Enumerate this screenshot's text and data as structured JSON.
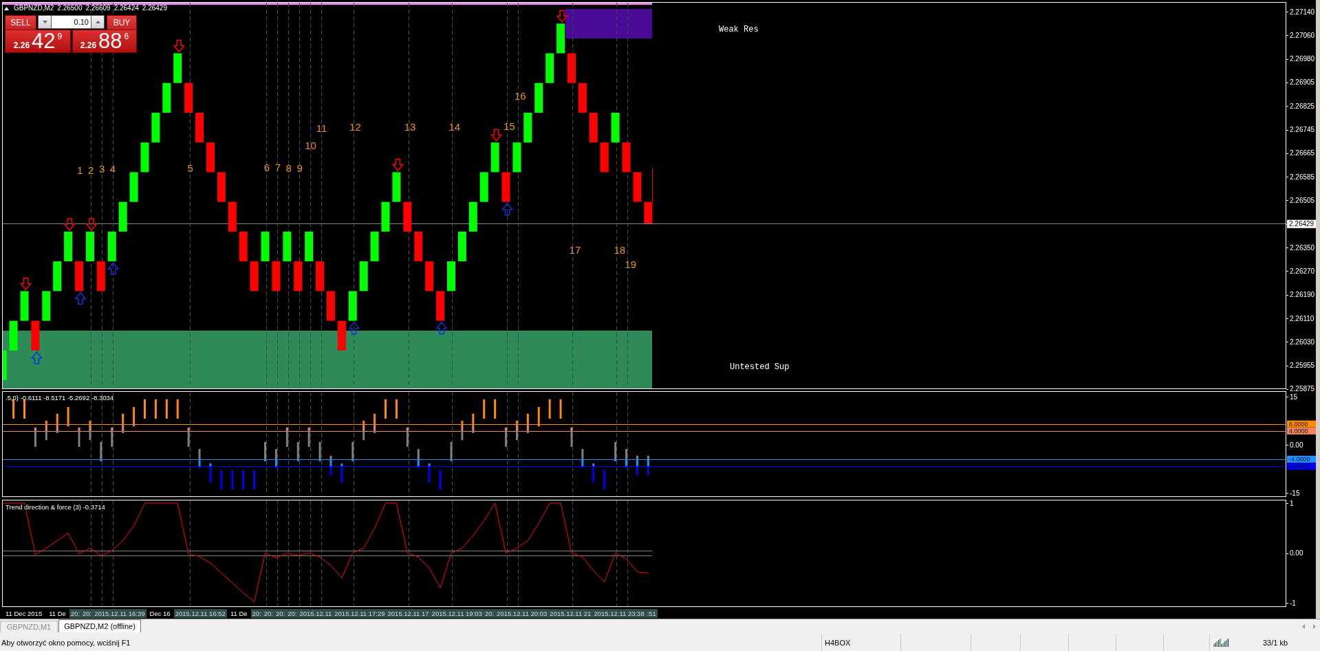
{
  "chart_header": {
    "symbol": "GBPNZD,M2",
    "prices": [
      "2.26500",
      "2.26609",
      "2.26424",
      "2.26429"
    ]
  },
  "one_click_trading": {
    "sell": {
      "label": "SELL",
      "price_prefix": "2.26",
      "price_big": "42",
      "price_pip": "9"
    },
    "lot": "0.10",
    "buy": {
      "label": "BUY",
      "price_prefix": "2.26",
      "price_big": "88",
      "price_pip": "6"
    }
  },
  "price_chart": {
    "zones": [
      {
        "kind": "resistance",
        "label": "Weak Res",
        "color": "#4c0a99"
      },
      {
        "kind": "support",
        "label": "Untested Sup",
        "color": "#2e8b57"
      }
    ],
    "signal_labels": [
      "1",
      "2",
      "3",
      "4",
      "5",
      "6",
      "7",
      "8",
      "9",
      "10",
      "11",
      "12",
      "13",
      "14",
      "15",
      "16",
      "17",
      "18",
      "19"
    ],
    "axis_labels": [
      {
        "text": "2.27140",
        "kind": "tick"
      },
      {
        "text": "2.27060",
        "kind": "tick"
      },
      {
        "text": "2.26980",
        "kind": "tick"
      },
      {
        "text": "2.26905",
        "kind": "tick"
      },
      {
        "text": "2.26825",
        "kind": "tick"
      },
      {
        "text": "2.26745",
        "kind": "tick"
      },
      {
        "text": "2.26665",
        "kind": "tick"
      },
      {
        "text": "2.26585",
        "kind": "tick"
      },
      {
        "text": "2.26505",
        "kind": "tick"
      },
      {
        "text": "2.26429",
        "kind": "current"
      },
      {
        "text": "2.26350",
        "kind": "tick"
      },
      {
        "text": "2.26270",
        "kind": "tick"
      },
      {
        "text": "2.26190",
        "kind": "tick"
      },
      {
        "text": "2.26110",
        "kind": "tick"
      },
      {
        "text": "2.26030",
        "kind": "tick"
      },
      {
        "text": "2.25955",
        "kind": "tick"
      },
      {
        "text": "2.25875",
        "kind": "tick"
      }
    ]
  },
  "oscillator": {
    "legend": ".5,0) -0.6111 -8.5171 -5.2692 -8.3034",
    "axis_labels": [
      "15",
      "0.00",
      "-15"
    ],
    "levels": [
      {
        "label": "6.0000",
        "color": "#ff8c00"
      },
      {
        "label": "4.0000",
        "color": "#f4845f"
      },
      {
        "label": "-4.0000",
        "color": "#1e90ff"
      },
      {
        "label": "-6.0000",
        "color": "#0000ff"
      }
    ]
  },
  "trend_panel": {
    "legend": "Trend direction & force (3) -0.3714",
    "axis_labels": [
      "1",
      "0.00",
      "-1"
    ]
  },
  "time_axis": [
    {
      "text": "11 Dec 2015",
      "kind": "date"
    },
    {
      "text": "11 De",
      "kind": "date"
    },
    {
      "text": "20:",
      "kind": "line"
    },
    {
      "text": "20:",
      "kind": "line"
    },
    {
      "text": "2015.12.11 16:39",
      "kind": "line"
    },
    {
      "text": "Dec 16",
      "kind": "date"
    },
    {
      "text": "2015.12.11 16:52",
      "kind": "line"
    },
    {
      "text": "11 De",
      "kind": "date"
    },
    {
      "text": "20:",
      "kind": "line"
    },
    {
      "text": "20:",
      "kind": "line"
    },
    {
      "text": "20:",
      "kind": "line"
    },
    {
      "text": "20:",
      "kind": "line"
    },
    {
      "text": "2015.12.11",
      "kind": "line"
    },
    {
      "text": "2015.12.11 17:29",
      "kind": "line"
    },
    {
      "text": "2015.12.11 17",
      "kind": "line"
    },
    {
      "text": "2015.12.11 19:03",
      "kind": "line"
    },
    {
      "text": "20:",
      "kind": "line"
    },
    {
      "text": "2015.12.11 20:03",
      "kind": "line"
    },
    {
      "text": "2015.12.11 21",
      "kind": "line"
    },
    {
      "text": "2015.12.11 23:38",
      "kind": "line"
    },
    {
      "text": ":51",
      "kind": "line"
    }
  ],
  "tabs": [
    {
      "label": "GBPNZD,M1",
      "selected": false
    },
    {
      "label": "GBPNZD,M2 (offline)",
      "selected": true
    }
  ],
  "status_bar": {
    "help": "Aby otworzyć okno pomocy, wciśnij F1",
    "profile": "H4BOX",
    "traffic": "33/1 kb"
  }
}
